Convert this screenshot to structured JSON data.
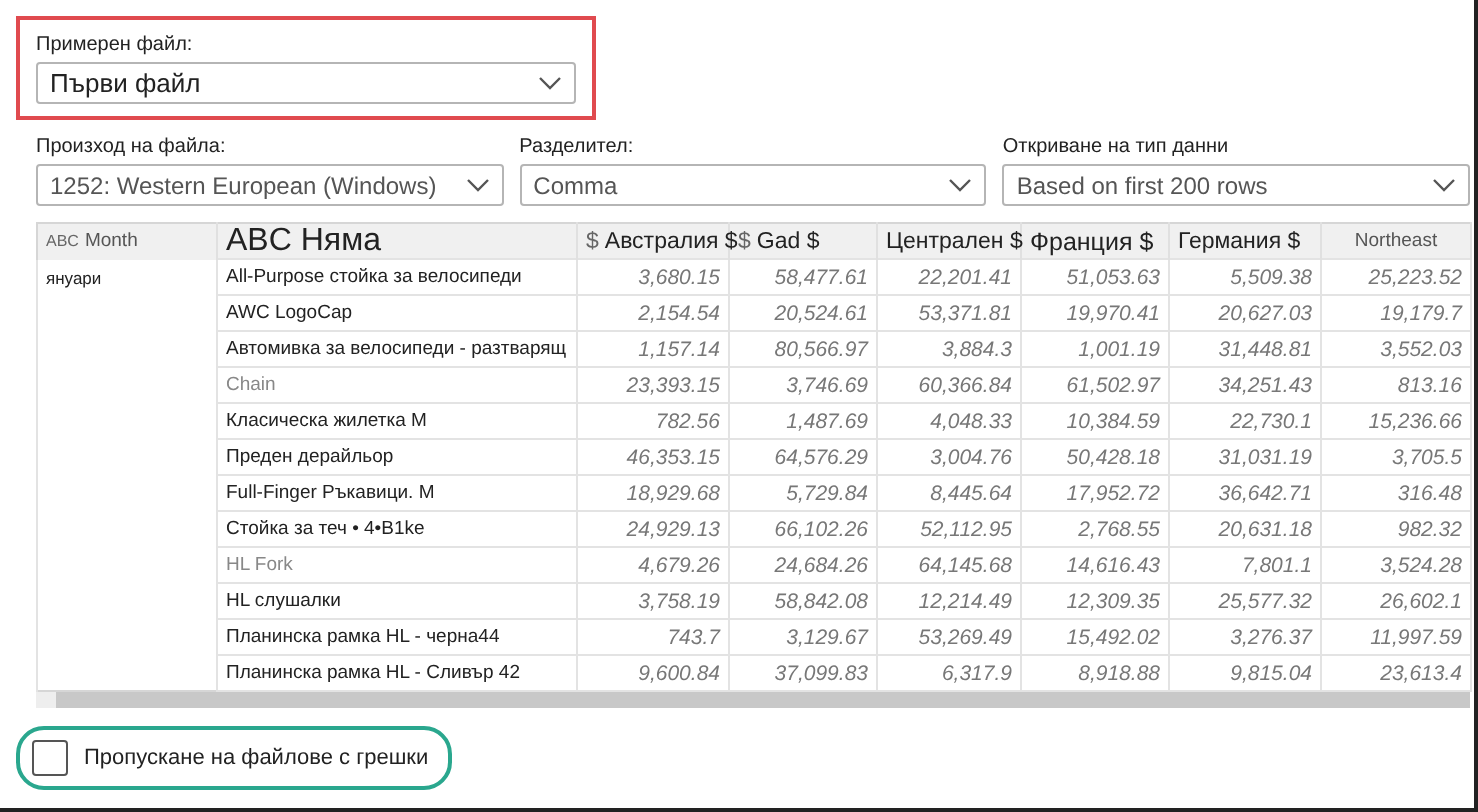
{
  "sample_file": {
    "label": "Примерен файл:",
    "value": "Първи файл"
  },
  "options": [
    {
      "label": "Произход на файла:",
      "value": "1252: Western European (Windows)"
    },
    {
      "label": "Разделител:",
      "value": "Comma"
    },
    {
      "label": "Откриване на тип данни",
      "value": "Based on first 200 rows"
    }
  ],
  "table": {
    "columns": [
      {
        "kind": "text",
        "icon": "ABC",
        "label": "Month"
      },
      {
        "kind": "large",
        "label": "ABC Няма"
      },
      {
        "kind": "currency",
        "icon": "$",
        "label": "Австралия $"
      },
      {
        "kind": "currency",
        "icon": "$",
        "label": "Gad $"
      },
      {
        "kind": "plain",
        "label": "Централен $"
      },
      {
        "kind": "medium",
        "label": "Франция $"
      },
      {
        "kind": "plain",
        "label": "Германия $"
      },
      {
        "kind": "muted",
        "label": "Northeast"
      }
    ],
    "rows": [
      {
        "month": "януари",
        "name": "All-Purpose стойка за велосипеди",
        "dimmed": false,
        "values": [
          "3,680.15",
          "58,477.61",
          "22,201.41",
          "51,053.63",
          "5,509.38",
          "25,223.52"
        ]
      },
      {
        "name": "AWC LogoCap",
        "dimmed": false,
        "values": [
          "2,154.54",
          "20,524.61",
          "53,371.81",
          "19,970.41",
          "20,627.03",
          "19,179.7"
        ]
      },
      {
        "name": "Автомивка за велосипеди - разтварящ",
        "dimmed": false,
        "values": [
          "1,157.14",
          "80,566.97",
          "3,884.3",
          "1,001.19",
          "31,448.81",
          "3,552.03"
        ]
      },
      {
        "name": "Chain",
        "dimmed": true,
        "values": [
          "23,393.15",
          "3,746.69",
          "60,366.84",
          "61,502.97",
          "34,251.43",
          "813.16"
        ]
      },
      {
        "name": "Класическа жилетка M",
        "dimmed": false,
        "values": [
          "782.56",
          "1,487.69",
          "4,048.33",
          "10,384.59",
          "22,730.1",
          "15,236.66"
        ]
      },
      {
        "name": "Преден дерайльор",
        "dimmed": false,
        "values": [
          "46,353.15",
          "64,576.29",
          "3,004.76",
          "50,428.18",
          "31,031.19",
          "3,705.5"
        ]
      },
      {
        "name": "Full-Finger Ръкавици. M",
        "dimmed": false,
        "values": [
          "18,929.68",
          "5,729.84",
          "8,445.64",
          "17,952.72",
          "36,642.71",
          "316.48"
        ]
      },
      {
        "name": "Стойка за теч • 4•B1ke",
        "dimmed": false,
        "values": [
          "24,929.13",
          "66,102.26",
          "52,112.95",
          "2,768.55",
          "20,631.18",
          "982.32"
        ]
      },
      {
        "name": "HL Fork",
        "dimmed": true,
        "values": [
          "4,679.26",
          "24,684.26",
          "64,145.68",
          "14,616.43",
          "7,801.1",
          "3,524.28"
        ]
      },
      {
        "name": "HL слушалки",
        "dimmed": false,
        "values": [
          "3,758.19",
          "58,842.08",
          "12,214.49",
          "12,309.35",
          "25,577.32",
          "26,602.1"
        ]
      },
      {
        "name": "Планинска рамка HL - черна44",
        "dimmed": false,
        "values": [
          "743.7",
          "3,129.67",
          "53,269.49",
          "15,492.02",
          "3,276.37",
          "11,997.59"
        ]
      },
      {
        "name": "Планинска рамка HL - Сливър 42",
        "dimmed": false,
        "values": [
          "9,600.84",
          "37,099.83",
          "6,317.9",
          "8,918.88",
          "9,815.04",
          "23,613.4"
        ]
      }
    ]
  },
  "skip_errors": {
    "label": "Пропускане на файлове с грешки",
    "checked": false
  }
}
